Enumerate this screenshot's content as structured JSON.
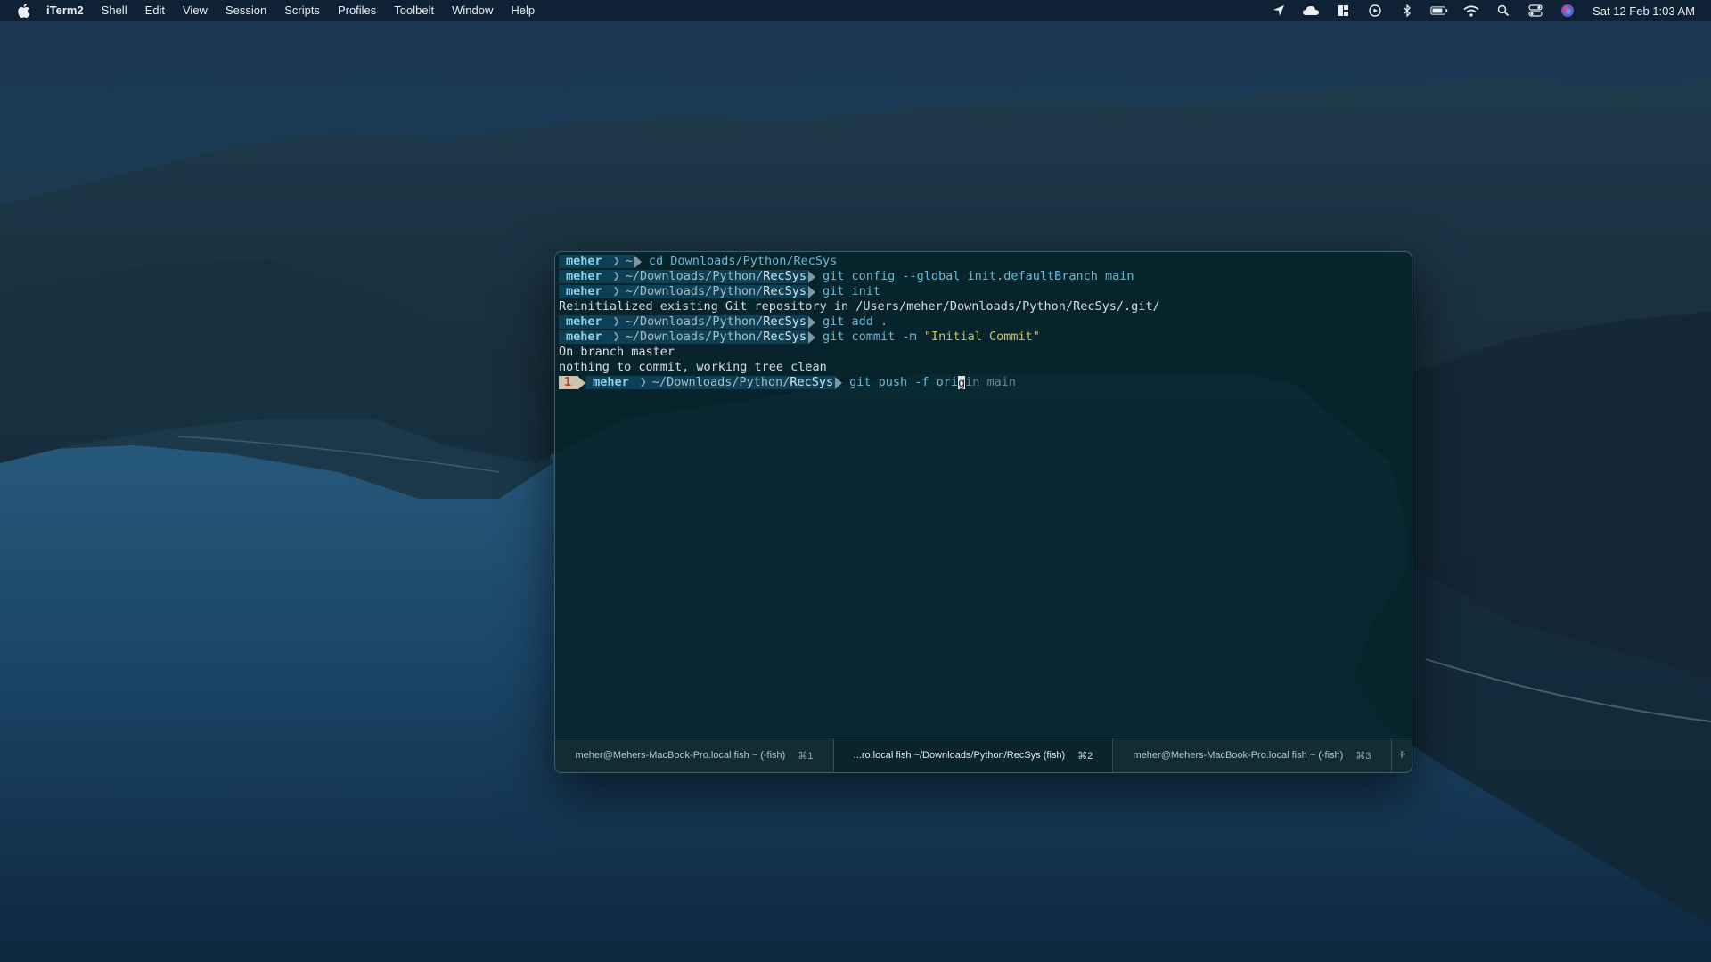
{
  "menubar": {
    "app_name": "iTerm2",
    "menus": [
      "Shell",
      "Edit",
      "View",
      "Session",
      "Scripts",
      "Profiles",
      "Toolbelt",
      "Window",
      "Help"
    ],
    "status_icons": [
      "location-arrow-icon",
      "cloud-icon",
      "window-grid-icon",
      "play-circle-icon",
      "bluetooth-icon",
      "battery-icon",
      "wifi-icon",
      "search-icon",
      "control-center-icon",
      "siri-icon"
    ],
    "clock": "Sat 12 Feb  1:03 AM"
  },
  "terminal": {
    "prompt_user": "meher",
    "lines": [
      {
        "type": "prompt",
        "path": "~",
        "cmd": "cd Downloads/Python/RecSys"
      },
      {
        "type": "prompt",
        "path_prefix": "~/Downloads/Python/",
        "path_last": "RecSys",
        "cmd": "git config --global init.defaultBranch main"
      },
      {
        "type": "prompt",
        "path_prefix": "~/Downloads/Python/",
        "path_last": "RecSys",
        "cmd": "git init"
      },
      {
        "type": "output",
        "text": "Reinitialized existing Git repository in /Users/meher/Downloads/Python/RecSys/.git/"
      },
      {
        "type": "prompt",
        "path_prefix": "~/Downloads/Python/",
        "path_last": "RecSys",
        "cmd": "git add ."
      },
      {
        "type": "prompt",
        "path_prefix": "~/Downloads/Python/",
        "path_last": "RecSys",
        "cmd": "git commit -m",
        "cmd_string": "\"Initial Commit\""
      },
      {
        "type": "output",
        "text": "On branch master"
      },
      {
        "type": "output",
        "text": "nothing to commit, working tree clean"
      },
      {
        "type": "prompt_active",
        "status": "1",
        "path_prefix": "~/Downloads/Python/",
        "path_last": "RecSys",
        "cmd_typed": "git push -f ori",
        "cursor_char": "g",
        "cmd_suggest": "in main"
      }
    ]
  },
  "tabs": [
    {
      "title": "meher@Mehers-MacBook-Pro.local fish ~ (-fish)",
      "key": "⌘1",
      "active": false
    },
    {
      "title": "...ro.local fish ~/Downloads/Python/RecSys (fish)",
      "key": "⌘2",
      "active": true
    },
    {
      "title": "meher@Mehers-MacBook-Pro.local fish ~ (-fish)",
      "key": "⌘3",
      "active": false
    }
  ],
  "tab_add_label": "+"
}
